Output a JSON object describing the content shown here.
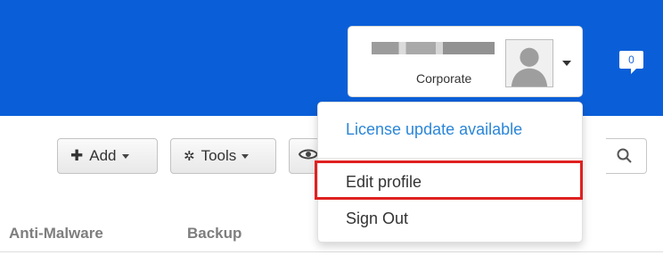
{
  "header": {
    "account": {
      "org": "Corporate"
    },
    "notification_count": "0"
  },
  "dropdown": {
    "license": "License update available",
    "edit_profile": "Edit profile",
    "sign_out": "Sign Out"
  },
  "toolbar": {
    "add_label": "Add",
    "tools_label": "Tools"
  },
  "table": {
    "columns": [
      "Anti-Malware",
      "Backup"
    ]
  },
  "colors": {
    "header_bg": "#0a5fd9",
    "link": "#2b86d8",
    "highlight": "#e02020"
  },
  "icons": [
    "user-avatar-icon",
    "chevron-down-icon",
    "chat-bubble-icon",
    "plus-icon",
    "gear-icon",
    "eye-icon",
    "search-icon"
  ]
}
